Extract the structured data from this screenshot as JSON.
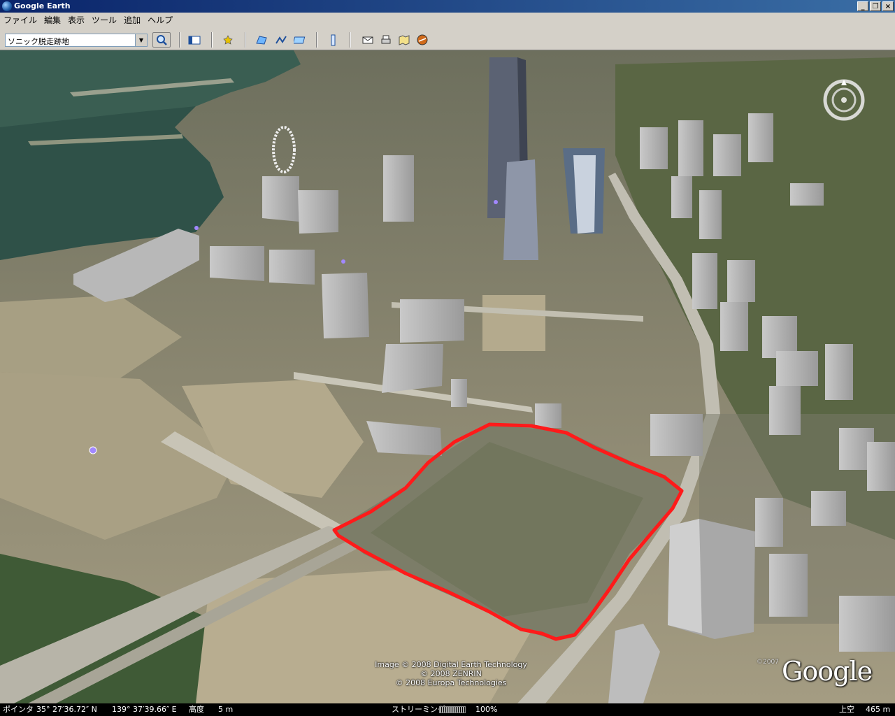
{
  "window": {
    "title": "Google Earth",
    "buttons": {
      "minimize": "_",
      "restore": "❐",
      "close": "×"
    }
  },
  "menu": [
    "ファイル",
    "編集",
    "表示",
    "ツール",
    "追加",
    "ヘルプ"
  ],
  "search": {
    "value": "ソニック脱走跡地"
  },
  "attribution": {
    "line1": "Image © 2008 Digital Earth Technology",
    "line2": "© 2008 ZENRIN",
    "line3": "© 2008 Europa Technologies"
  },
  "logo": {
    "text": "Google",
    "year": "©2007"
  },
  "status": {
    "pointer_label": "ポインタ",
    "lat": "35°  27′36.72″ N",
    "lon": "139°  37′39.66″ E",
    "elev_label": "高度",
    "elev_value": "5 m",
    "streaming_label": "ストリーミング",
    "streaming_pct": "100%",
    "eye_label": "上空",
    "eye_value": "465 m"
  },
  "colors": {
    "outline": "#ff1a1a",
    "water": "#2e4f46",
    "titlebar": "#0a246a"
  }
}
